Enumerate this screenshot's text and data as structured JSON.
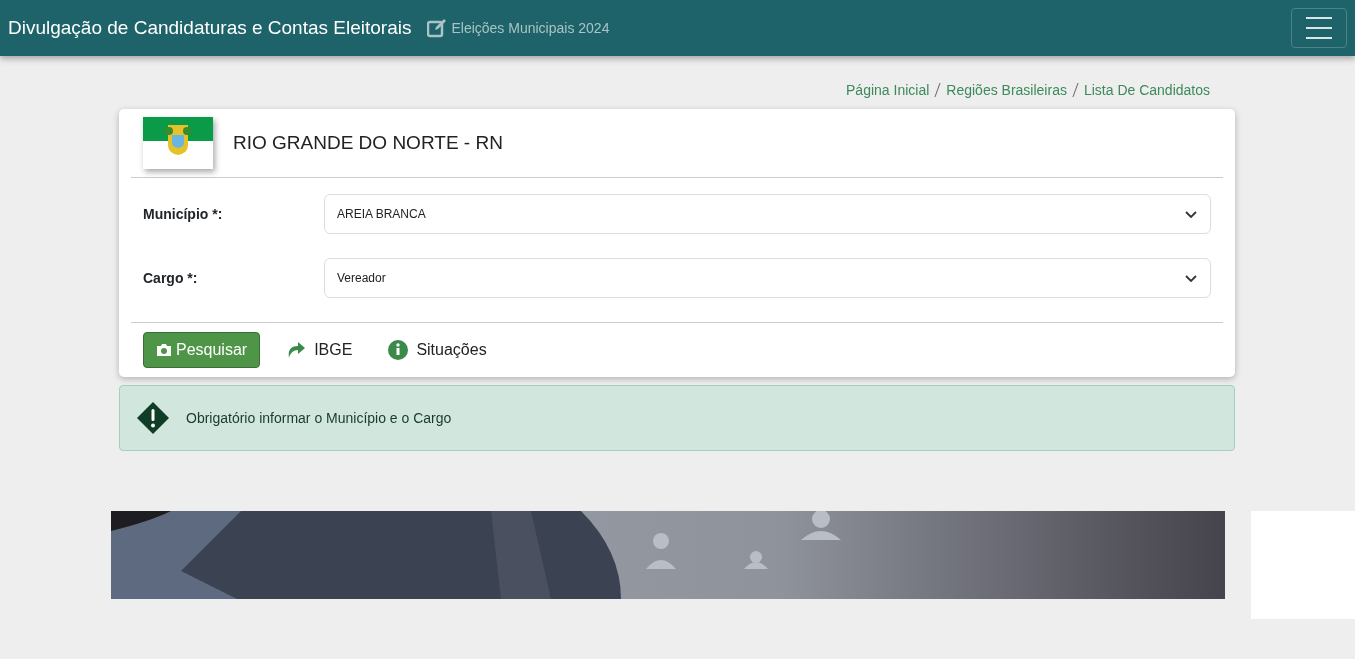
{
  "navbar": {
    "title": "Divulgação de Candidaturas e Contas Eleitorais",
    "subtitle": "Eleições Municipais 2024"
  },
  "breadcrumb": [
    {
      "label": "Página Inicial"
    },
    {
      "label": "Regiões Brasileiras"
    },
    {
      "label": "Lista De Candidatos"
    }
  ],
  "state_card": {
    "title": "RIO GRANDE DO NORTE - RN",
    "fields": [
      {
        "label": "Município *:",
        "value": "AREIA BRANCA"
      },
      {
        "label": "Cargo *:",
        "value": "Vereador"
      }
    ],
    "actions": [
      {
        "kind": "primary",
        "label": "Pesquisar"
      },
      {
        "kind": "link",
        "label": "IBGE"
      },
      {
        "kind": "link",
        "label": "Situações"
      }
    ]
  },
  "alert": {
    "message": "Obrigatório informar o Município e o Cargo"
  }
}
